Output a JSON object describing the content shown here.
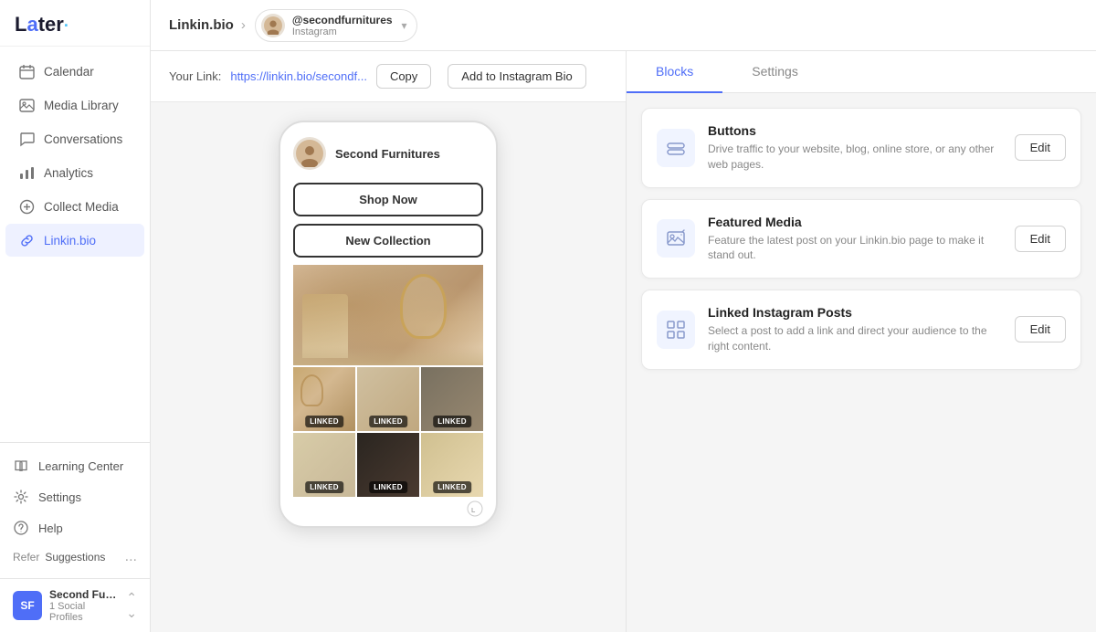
{
  "app": {
    "logo": "Later",
    "logo_accent": "·"
  },
  "sidebar": {
    "nav_items": [
      {
        "id": "calendar",
        "label": "Calendar",
        "icon": "calendar-icon"
      },
      {
        "id": "media-library",
        "label": "Media Library",
        "icon": "image-icon"
      },
      {
        "id": "conversations",
        "label": "Conversations",
        "icon": "chat-icon"
      },
      {
        "id": "analytics",
        "label": "Analytics",
        "icon": "chart-icon"
      },
      {
        "id": "collect-media",
        "label": "Collect Media",
        "icon": "collect-icon"
      },
      {
        "id": "linkin-bio",
        "label": "Linkin.bio",
        "icon": "link-icon",
        "active": true
      }
    ],
    "bottom_items": [
      {
        "id": "learning-center",
        "label": "Learning Center",
        "icon": "book-icon"
      },
      {
        "id": "settings",
        "label": "Settings",
        "icon": "gear-icon"
      },
      {
        "id": "help",
        "label": "Help",
        "icon": "help-icon"
      }
    ],
    "refer": {
      "label": "Refer",
      "suggestions": "Suggestions",
      "more": "..."
    },
    "account": {
      "initials": "SF",
      "name": "Second Furnitur...",
      "sub": "1 Social Profiles"
    }
  },
  "topbar": {
    "breadcrumb": "Linkin.bio",
    "account_name": "@secondfurnitures",
    "account_type": "Instagram"
  },
  "link_bar": {
    "label": "Your Link:",
    "url": "https://linkin.bio/secondf...",
    "copy_btn": "Copy",
    "instagram_btn": "Add to Instagram Bio"
  },
  "phone_preview": {
    "username": "Second Furnitures",
    "btn1": "Shop Now",
    "btn2": "New Collection",
    "linked_label": "LINKED"
  },
  "right_panel": {
    "tabs": [
      {
        "id": "blocks",
        "label": "Blocks",
        "active": true
      },
      {
        "id": "settings",
        "label": "Settings",
        "active": false
      }
    ],
    "blocks": [
      {
        "id": "buttons",
        "title": "Buttons",
        "description": "Drive traffic to your website, blog, online store, or any other web pages.",
        "edit_label": "Edit",
        "icon": "buttons-icon"
      },
      {
        "id": "featured-media",
        "title": "Featured Media",
        "description": "Feature the latest post on your Linkin.bio page to make it stand out.",
        "edit_label": "Edit",
        "icon": "featured-media-icon"
      },
      {
        "id": "linked-instagram-posts",
        "title": "Linked Instagram Posts",
        "description": "Select a post to add a link and direct your audience to the right content.",
        "edit_label": "Edit",
        "icon": "grid-icon"
      }
    ]
  }
}
